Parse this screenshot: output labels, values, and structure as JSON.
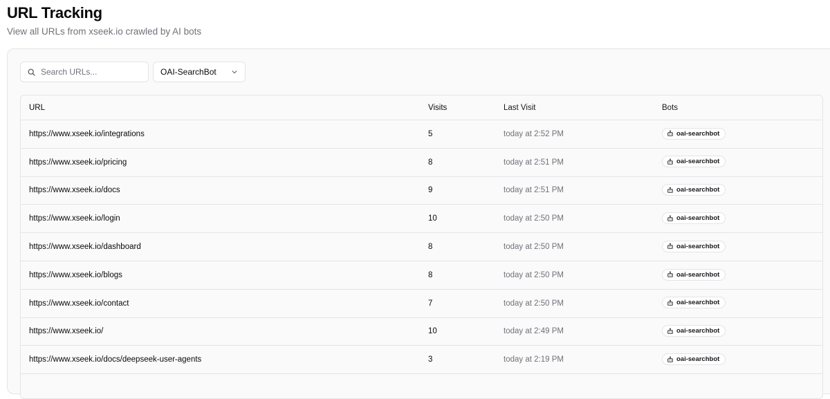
{
  "header": {
    "title": "URL Tracking",
    "subtitle": "View all URLs from xseek.io crawled by AI bots"
  },
  "toolbar": {
    "search_placeholder": "Search URLs...",
    "search_value": "",
    "bot_filter": "OAI-SearchBot"
  },
  "table": {
    "columns": [
      "URL",
      "Visits",
      "Last Visit",
      "Bots"
    ],
    "rows": [
      {
        "url": "https://www.xseek.io/integrations",
        "visits": "5",
        "last_visit": "today at 2:52 PM",
        "bot": "oai-searchbot"
      },
      {
        "url": "https://www.xseek.io/pricing",
        "visits": "8",
        "last_visit": "today at 2:51 PM",
        "bot": "oai-searchbot"
      },
      {
        "url": "https://www.xseek.io/docs",
        "visits": "9",
        "last_visit": "today at 2:51 PM",
        "bot": "oai-searchbot"
      },
      {
        "url": "https://www.xseek.io/login",
        "visits": "10",
        "last_visit": "today at 2:50 PM",
        "bot": "oai-searchbot"
      },
      {
        "url": "https://www.xseek.io/dashboard",
        "visits": "8",
        "last_visit": "today at 2:50 PM",
        "bot": "oai-searchbot"
      },
      {
        "url": "https://www.xseek.io/blogs",
        "visits": "8",
        "last_visit": "today at 2:50 PM",
        "bot": "oai-searchbot"
      },
      {
        "url": "https://www.xseek.io/contact",
        "visits": "7",
        "last_visit": "today at 2:50 PM",
        "bot": "oai-searchbot"
      },
      {
        "url": "https://www.xseek.io/",
        "visits": "10",
        "last_visit": "today at 2:49 PM",
        "bot": "oai-searchbot"
      },
      {
        "url": "https://www.xseek.io/docs/deepseek-user-agents",
        "visits": "3",
        "last_visit": "today at 2:19 PM",
        "bot": "oai-searchbot"
      }
    ]
  },
  "icons": {
    "search": "search-icon",
    "dropdown": "chevron-down-icon",
    "bot": "bot-icon"
  }
}
